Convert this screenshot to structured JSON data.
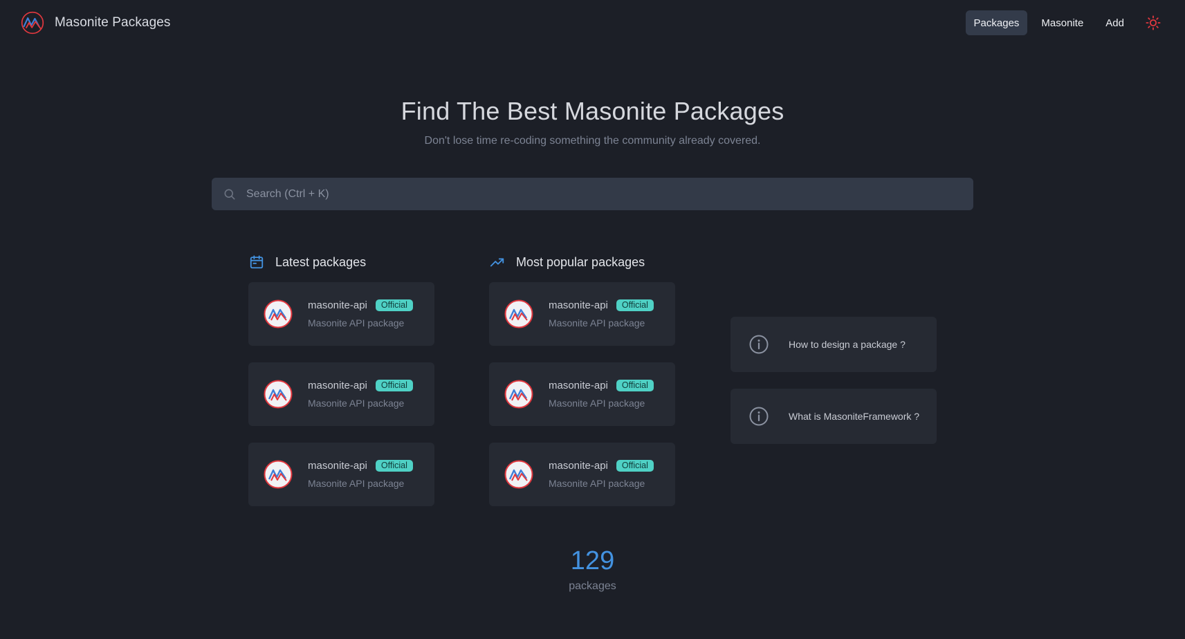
{
  "header": {
    "title": "Masonite Packages",
    "nav": [
      "Packages",
      "Masonite",
      "Add"
    ],
    "active_nav": "Packages"
  },
  "hero": {
    "title": "Find The Best Masonite Packages",
    "subtitle": "Don't lose time re-coding something the community already covered."
  },
  "search": {
    "placeholder": "Search (Ctrl + K)"
  },
  "latest": {
    "heading": "Latest packages",
    "items": [
      {
        "name": "masonite-api",
        "badge": "Official",
        "description": "Masonite API package"
      },
      {
        "name": "masonite-api",
        "badge": "Official",
        "description": "Masonite API package"
      },
      {
        "name": "masonite-api",
        "badge": "Official",
        "description": "Masonite API package"
      }
    ]
  },
  "popular": {
    "heading": "Most popular packages",
    "items": [
      {
        "name": "masonite-api",
        "badge": "Official",
        "description": "Masonite API package"
      },
      {
        "name": "masonite-api",
        "badge": "Official",
        "description": "Masonite API package"
      },
      {
        "name": "masonite-api",
        "badge": "Official",
        "description": "Masonite API package"
      }
    ]
  },
  "info": [
    {
      "label": "How to design a package ?",
      "icon": "info-icon"
    },
    {
      "label": "What is MasoniteFramework ?",
      "icon": "info-icon"
    }
  ],
  "stats": {
    "count": "129",
    "label": "packages"
  },
  "colors": {
    "background": "#1c1f27",
    "card": "#262a33",
    "accent": "#4392e0",
    "badge": "#4fd1c5",
    "brand_red": "#e2383f"
  }
}
